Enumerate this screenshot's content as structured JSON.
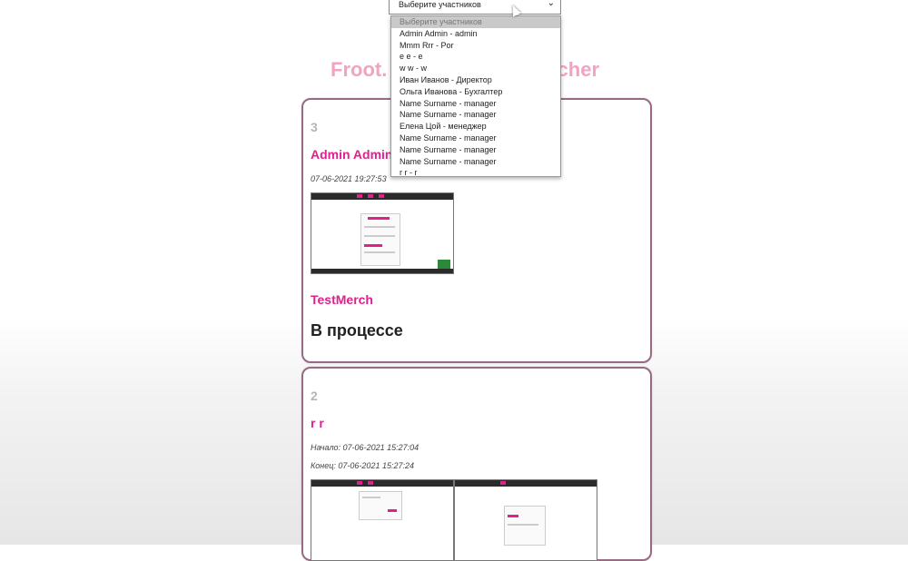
{
  "title": {
    "left": "Froot.",
    "right": "atcher"
  },
  "select": {
    "placeholder": "Выберите участников",
    "options": [
      "Выберите участников",
      "Admin Admin - admin",
      "Mmm Rrr - Por",
      "e e - e",
      "w w - w",
      "Иван Иванов - Директор",
      "Ольга Иванова - Бухгалтер",
      "Name Surname - manager",
      "Name Surname - manager",
      "Елена Цой - менеджер",
      "Name Surname - manager",
      "Name Surname - manager",
      "Name Surname - manager",
      "r r - r"
    ]
  },
  "cards": [
    {
      "id": "3",
      "user": "Admin Admin",
      "date": "07-06-2021 19:27:53",
      "merch": "TestMerch",
      "status": "В процессе"
    },
    {
      "id": "2",
      "user": "r r",
      "start": "Начало: 07-06-2021 15:27:04",
      "end": "Конец: 07-06-2021 15:27:24"
    }
  ],
  "colors": {
    "accent": "#e0208c",
    "title": "#f2a3c2",
    "border": "#9a6a85"
  }
}
